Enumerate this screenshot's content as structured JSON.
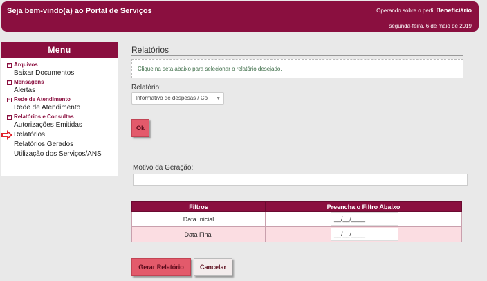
{
  "header": {
    "welcome": "Seja bem-vindo(a) ao Portal de Serviços",
    "perfil_prefix": "Operando sobre o perfil",
    "perfil_name": "Beneficiário",
    "date": "segunda-feira, 6 de maio de 2019"
  },
  "sidebar": {
    "title": "Menu",
    "sections": [
      {
        "label": "Arquivos",
        "items": [
          "Baixar Documentos"
        ]
      },
      {
        "label": "Mensagens",
        "items": [
          "Alertas"
        ]
      },
      {
        "label": "Rede de Atendimento",
        "items": [
          "Rede de Atendimento"
        ]
      },
      {
        "label": "Relatórios e Consultas",
        "items": [
          "Autorizações Emitidas",
          "Relatórios",
          "Relatórios Gerados",
          "Utilização dos Serviços/ANS"
        ]
      }
    ],
    "minus_glyph": "−"
  },
  "main": {
    "title": "Relatórios",
    "info": "Clique na seta abaixo para selecionar o relatório desejado.",
    "relatorio_label": "Relatório:",
    "relatorio_value": "Informativo de despesas / Co",
    "ok_label": "Ok",
    "motivo_label": "Motivo da Geração:",
    "table": {
      "headers": [
        "Filtros",
        "Preencha o Filtro Abaixo"
      ],
      "rows": [
        {
          "label": "Data Inicial",
          "value": "__/__/____"
        },
        {
          "label": "Data Final",
          "value": "__/__/____"
        }
      ]
    },
    "gerar_label": "Gerar Relatório",
    "cancelar_label": "Cancelar"
  },
  "colors": {
    "brand": "#8a0f3f",
    "button": "#e35a6b",
    "arrow": "#e0202a"
  }
}
